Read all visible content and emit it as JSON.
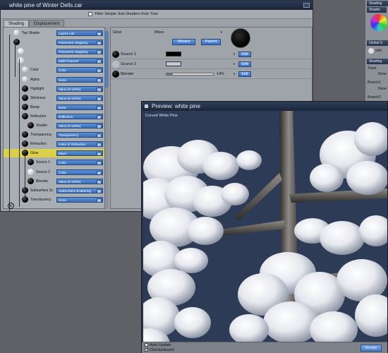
{
  "main_window": {
    "title": "white pine of Winter Dells.car",
    "filter_label": "Filter Simple Sub-Shaders from Tree",
    "tabs": [
      "Shading",
      "Displacement"
    ]
  },
  "tree": {
    "rows": [
      {
        "label": "Top Shader",
        "value": "Layers List"
      },
      {
        "label": "",
        "value": "Parametric Mapping"
      },
      {
        "label": "",
        "value": "Parametric Mapping"
      },
      {
        "label": "",
        "value": "Multi Channel"
      },
      {
        "label": "Color",
        "value": "Color"
      },
      {
        "label": "Alpha",
        "value": "None"
      },
      {
        "label": "Highlight",
        "value": "Value (0-100%)"
      },
      {
        "label": "Shininess",
        "value": "Value (0-100%)"
      },
      {
        "label": "Bump",
        "value": "None"
      },
      {
        "label": "Reflection",
        "value": "Reflection"
      },
      {
        "label": "Shader",
        "value": "Value (0-100%)"
      },
      {
        "label": "Transparency",
        "value": "Transparency"
      },
      {
        "label": "Refraction",
        "value": "Index of Refraction"
      },
      {
        "label": "Glow",
        "value": "Mixer"
      },
      {
        "label": "Source 1",
        "value": "Color"
      },
      {
        "label": "Source 2",
        "value": "Color"
      },
      {
        "label": "Blender",
        "value": "Value (0-100%)"
      },
      {
        "label": "Subsurface Sc",
        "value": "SubSurface Scattering"
      },
      {
        "label": "Translucency",
        "value": "None"
      }
    ],
    "selected_index": 13
  },
  "detail": {
    "name": "Glow",
    "type": "Mixer",
    "wizard_label": "Wizard",
    "parent_label": "Parent",
    "source1_label": "Source 1",
    "source2_label": "Source 2",
    "blender_label": "Blender",
    "blender_value": "14%",
    "blender_fraction": 0.14,
    "edit_label": "Edit",
    "chevron": "∨"
  },
  "preview": {
    "title": "Preview: white pine",
    "object_label": "Curved White Pine",
    "auto_update_label": "Auto Update",
    "auto_update_checked": false,
    "checkerboard_label": "Checkerboard",
    "checkerboard_checked": true,
    "render_label": "Render"
  },
  "dock": {
    "shading_header": "Shading",
    "shader_header": "Shader",
    "global_header": "Global S",
    "white_label": "whit",
    "shading2_header": "Shading",
    "trunk_label": "Trunk",
    "none1_label": "None",
    "branch1_label": "Branch1",
    "none2_label": "None",
    "branch2_label": "Branch2"
  },
  "colors": {
    "accent_blue": "#3d6fb8",
    "selection_yellow": "#dcd04a",
    "title_bar": "#1a2438",
    "sky": "#2d3a55"
  }
}
